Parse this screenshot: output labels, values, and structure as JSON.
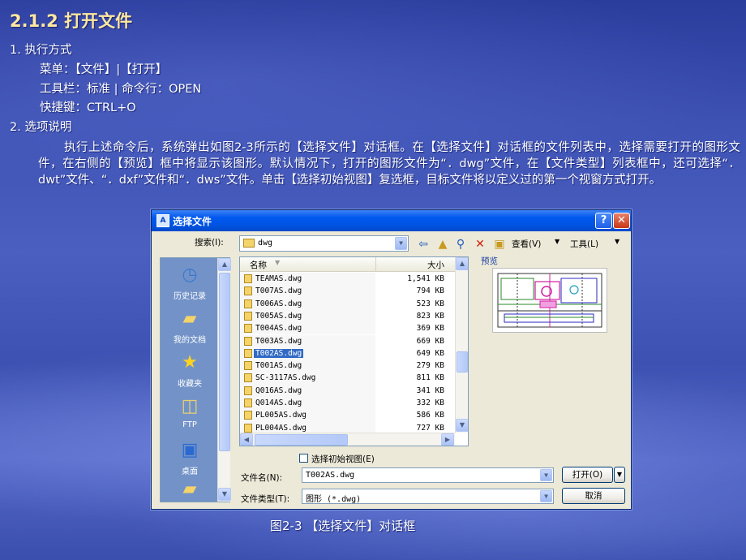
{
  "slide": {
    "title": "2.1.2 打开文件",
    "section1": "1. 执行方式",
    "menu_line": "菜单：【文件】|【打开】",
    "toolbar_line": "工具栏：标准 | 命令行：OPEN",
    "shortcut_line": "快捷键：CTRL+O",
    "section2": "2. 选项说明",
    "paragraph": "执行上述命令后，系统弹出如图2-3所示的【选择文件】对话框。在【选择文件】对话框的文件列表中，选择需要打开的图形文件，在右侧的【预览】框中将显示该图形。默认情况下，打开的图形文件为“．dwg”文件，在【文件类型】列表框中，还可选择“．dwt”文件、“．dxf”文件和“．dws”文件。单击【选择初始视图】复选框，目标文件将以定义过的第一个视窗方式打开。",
    "caption": "图2-3 【选择文件】对话框"
  },
  "dialog": {
    "title": "选择文件",
    "search_label": "搜索(I):",
    "search_value": "dwg",
    "view_label": "查看(V)",
    "tools_label": "工具(L)",
    "places": [
      {
        "label": "历史记录",
        "icon": "history-icon"
      },
      {
        "label": "我的文档",
        "icon": "my-documents-icon"
      },
      {
        "label": "收藏夹",
        "icon": "favorites-star-icon"
      },
      {
        "label": "FTP",
        "icon": "ftp-icon"
      },
      {
        "label": "桌面",
        "icon": "desktop-icon"
      }
    ],
    "columns": {
      "name": "名称",
      "size": "大小"
    },
    "files": [
      {
        "name": "TEAMAS.dwg",
        "size": "1,541 KB"
      },
      {
        "name": "T007AS.dwg",
        "size": "794 KB"
      },
      {
        "name": "T006AS.dwg",
        "size": "523 KB"
      },
      {
        "name": "T005AS.dwg",
        "size": "823 KB"
      },
      {
        "name": "T004AS.dwg",
        "size": "369 KB"
      },
      {
        "name": "T003AS.dwg",
        "size": "669 KB"
      },
      {
        "name": "T002AS.dwg",
        "size": "649 KB",
        "selected": true
      },
      {
        "name": "T001AS.dwg",
        "size": "279 KB"
      },
      {
        "name": "SC-3117AS.dwg",
        "size": "811 KB"
      },
      {
        "name": "Q016AS.dwg",
        "size": "341 KB"
      },
      {
        "name": "Q014AS.dwg",
        "size": "332 KB"
      },
      {
        "name": "PL005AS.dwg",
        "size": "586 KB"
      },
      {
        "name": "PL004AS.dwg",
        "size": "727 KB"
      }
    ],
    "preview_label": "预览",
    "initial_view_label": "选择初始视图(E)",
    "filename_label": "文件名(N):",
    "filename_value": "T002AS.dwg",
    "filetype_label": "文件类型(T):",
    "filetype_value": "图形 (*.dwg)",
    "open_label": "打开(O)",
    "cancel_label": "取消",
    "help_glyph": "?",
    "close_glyph": "✕"
  }
}
